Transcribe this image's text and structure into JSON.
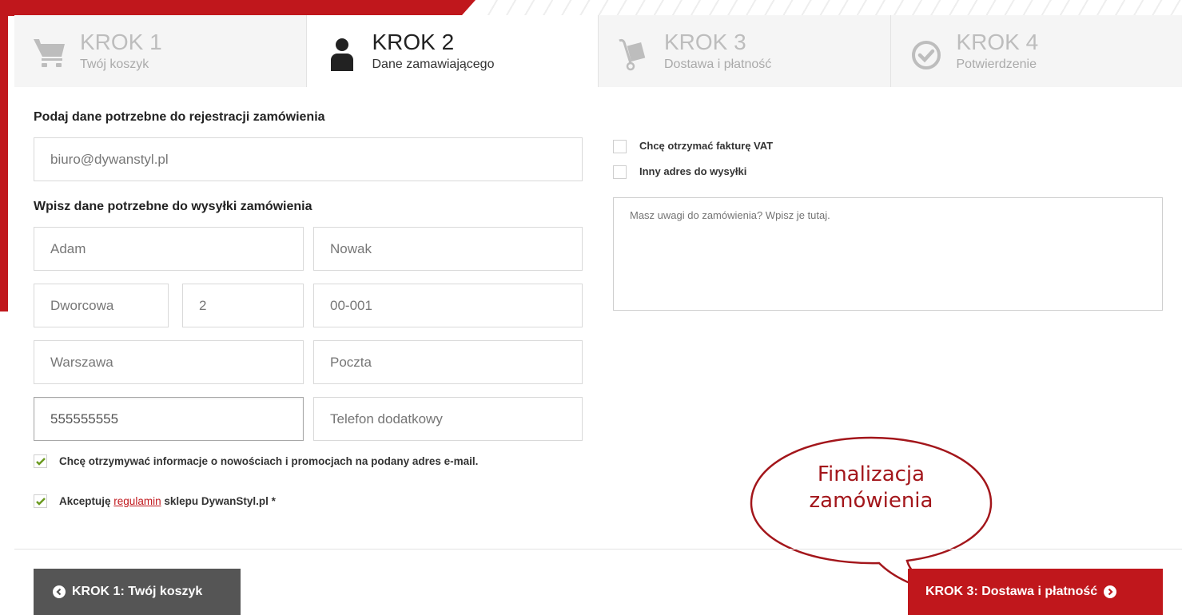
{
  "steps": [
    {
      "num": "KROK 1",
      "label": "Twój koszyk",
      "icon": "cart-icon"
    },
    {
      "num": "KROK 2",
      "label": "Dane zamawiającego",
      "icon": "user-icon"
    },
    {
      "num": "KROK 3",
      "label": "Dostawa i płatność",
      "icon": "hand-truck-icon"
    },
    {
      "num": "KROK 4",
      "label": "Potwierdzenie",
      "icon": "check-circle-icon"
    }
  ],
  "active_step": 2,
  "form": {
    "register_heading": "Podaj dane potrzebne do rejestracji zamówienia",
    "email": "biuro@dywanstyl.pl",
    "shipping_heading": "Wpisz dane potrzebne do wysyłki zamówienia",
    "first_name": "Adam",
    "last_name": "Nowak",
    "street": "Dworcowa",
    "house_number": "2",
    "postal_code": "00-001",
    "city": "Warszawa",
    "post_office_placeholder": "Poczta",
    "phone": "555555555",
    "phone2_placeholder": "Telefon dodatkowy",
    "newsletter_label": "Chcę otrzymywać informacje o nowościach i promocjach na podany adres e-mail.",
    "newsletter_checked": true,
    "terms_prefix": "Akceptuję",
    "terms_link": "regulamin",
    "terms_suffix": "sklepu DywanStyl.pl *",
    "terms_checked": true,
    "vat_label": "Chcę otrzymać fakturę VAT",
    "vat_checked": false,
    "other_address_label": "Inny adres do wysyłki",
    "other_address_checked": false,
    "notes_placeholder": "Masz uwagi do zamówienia? Wpisz je tutaj."
  },
  "buttons": {
    "back": "KROK 1: Twój koszyk",
    "next": "KROK 3: Dostawa i płatność"
  },
  "callout": {
    "line1": "Finalizacja",
    "line2": "zamówienia"
  },
  "colors": {
    "accent": "#c0171c",
    "back_button": "#555555",
    "check_green": "#6a9a1f"
  }
}
